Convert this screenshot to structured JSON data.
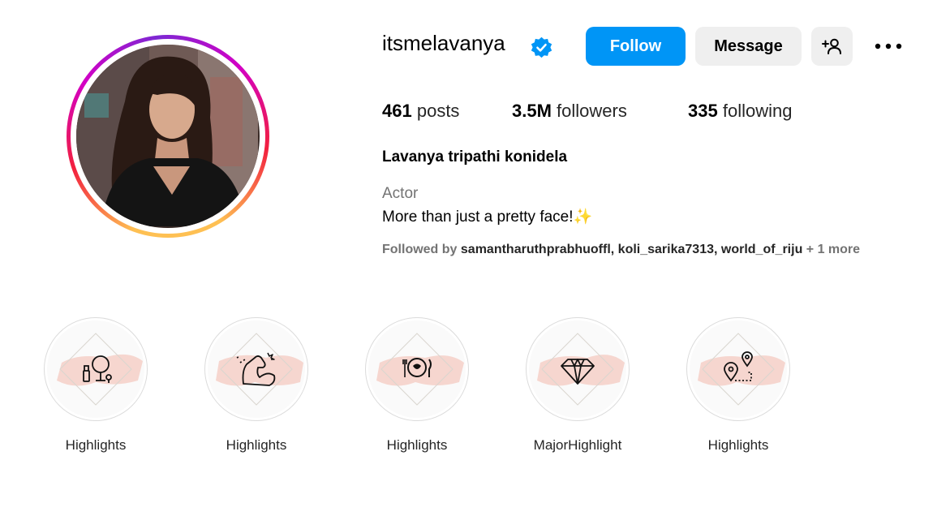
{
  "profile": {
    "username": "itsmelavanya",
    "verified_icon": "verified-badge-icon",
    "follow_label": "Follow",
    "message_label": "Message",
    "suggest_icon": "person-add-icon",
    "more_icon": "more-options-icon",
    "accent_color": "#0095f6"
  },
  "stats": {
    "posts_count": "461",
    "posts_label": "posts",
    "followers_count": "3.5M",
    "followers_label": "followers",
    "following_count": "335",
    "following_label": "following"
  },
  "bio": {
    "full_name": "Lavanya tripathi konidela",
    "category": "Actor",
    "text": "More than just a pretty face!✨",
    "followed_by_prefix": "Followed by ",
    "followed_by_accounts": [
      "samantharuthprabhuoffl",
      "koli_sarika7313",
      "world_of_riju"
    ],
    "followed_by_more": " + 1 more"
  },
  "highlights": [
    {
      "label": "Highlights",
      "icon": "makeup-mirror-icon"
    },
    {
      "label": "Highlights",
      "icon": "flexed-arm-icon"
    },
    {
      "label": "Highlights",
      "icon": "plate-cutlery-icon"
    },
    {
      "label": "MajorHighlight",
      "icon": "diamond-icon"
    },
    {
      "label": "Highlights",
      "icon": "map-pin-route-icon"
    }
  ]
}
